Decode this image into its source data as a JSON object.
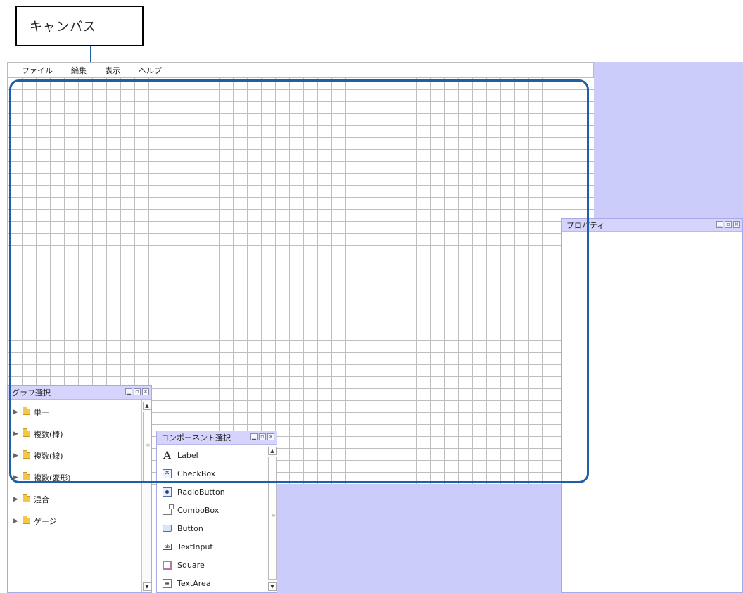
{
  "callout": {
    "label": "キャンバス"
  },
  "menubar": {
    "items": [
      "ファイル",
      "編集",
      "表示",
      "ヘルプ"
    ]
  },
  "colors": {
    "highlight": "#1f5fa8",
    "panel_bg": "#ccccfb"
  },
  "properties_panel": {
    "title": "プロパティ"
  },
  "graph_panel": {
    "title": "グラフ選択",
    "items": [
      "単一",
      "複数(棒)",
      "複数(線)",
      "複数(変形)",
      "混合",
      "ゲージ"
    ]
  },
  "component_panel": {
    "title": "コンポーネント選択",
    "items": [
      {
        "label": "Label",
        "icon": "label-icon"
      },
      {
        "label": "CheckBox",
        "icon": "checkbox-icon"
      },
      {
        "label": "RadioButton",
        "icon": "radio-button-icon"
      },
      {
        "label": "ComboBox",
        "icon": "combobox-icon"
      },
      {
        "label": "Button",
        "icon": "button-icon"
      },
      {
        "label": "TextInput",
        "icon": "text-input-icon"
      },
      {
        "label": "Square",
        "icon": "square-icon"
      },
      {
        "label": "TextArea",
        "icon": "text-area-icon"
      }
    ]
  }
}
